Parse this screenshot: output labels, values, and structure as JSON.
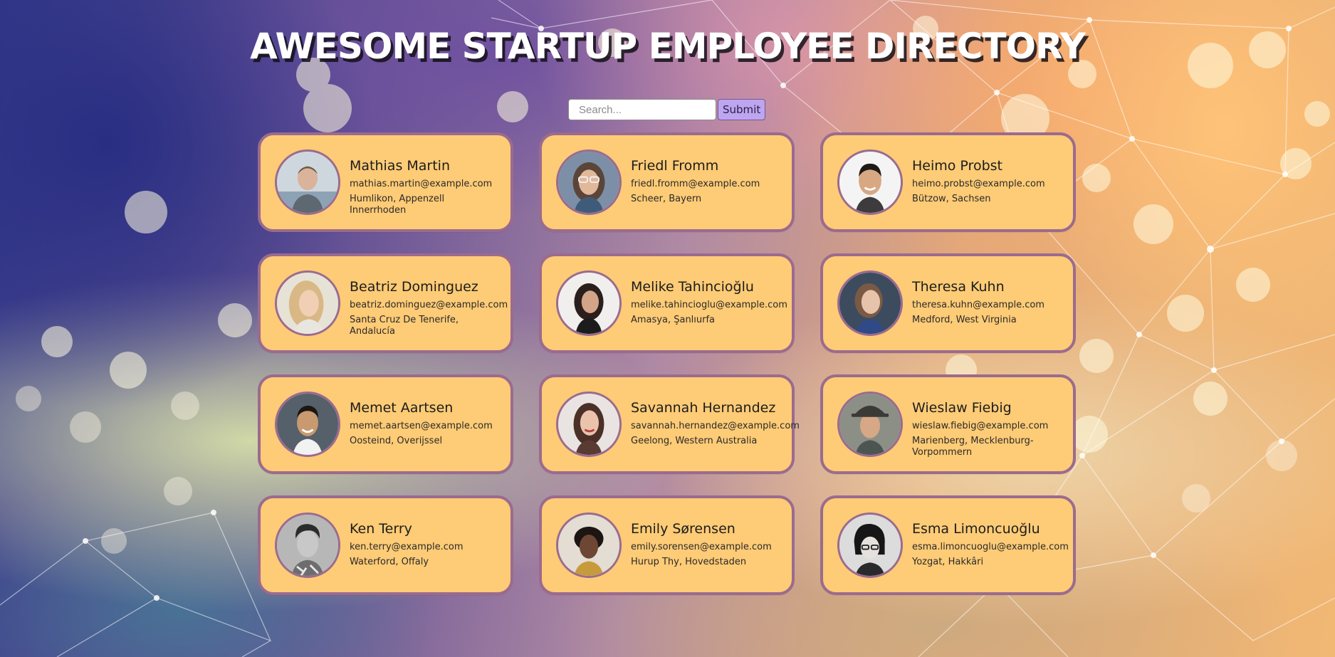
{
  "header": {
    "title": "AWESOME STARTUP EMPLOYEE DIRECTORY"
  },
  "search": {
    "placeholder": "Search...",
    "value": "",
    "submit_label": "Submit"
  },
  "colors": {
    "card_background": "#fecb76",
    "card_border": "#9b6b8e",
    "submit_button": "#bda5f0"
  },
  "employees": [
    {
      "name": "Mathias Martin",
      "email": "mathias.martin@example.com",
      "location": "Humlikon, Appenzell Innerrhoden"
    },
    {
      "name": "Friedl Fromm",
      "email": "friedl.fromm@example.com",
      "location": "Scheer, Bayern"
    },
    {
      "name": "Heimo Probst",
      "email": "heimo.probst@example.com",
      "location": "Bützow, Sachsen"
    },
    {
      "name": "Beatriz Dominguez",
      "email": "beatriz.dominguez@example.com",
      "location": "Santa Cruz De Tenerife, Andalucía"
    },
    {
      "name": "Melike Tahincioğlu",
      "email": "melike.tahincioglu@example.com",
      "location": "Amasya, Şanlıurfa"
    },
    {
      "name": "Theresa Kuhn",
      "email": "theresa.kuhn@example.com",
      "location": "Medford, West Virginia"
    },
    {
      "name": "Memet Aartsen",
      "email": "memet.aartsen@example.com",
      "location": "Oosteind, Overijssel"
    },
    {
      "name": "Savannah Hernandez",
      "email": "savannah.hernandez@example.com",
      "location": "Geelong, Western Australia"
    },
    {
      "name": "Wieslaw Fiebig",
      "email": "wieslaw.fiebig@example.com",
      "location": "Marienberg, Mecklenburg-Vorpommern"
    },
    {
      "name": "Ken Terry",
      "email": "ken.terry@example.com",
      "location": "Waterford, Offaly"
    },
    {
      "name": "Emily Sørensen",
      "email": "emily.sorensen@example.com",
      "location": "Hurup Thy, Hovedstaden"
    },
    {
      "name": "Esma Limoncuoğlu",
      "email": "esma.limoncuoglu@example.com",
      "location": "Yozgat, Hakkâri"
    }
  ]
}
